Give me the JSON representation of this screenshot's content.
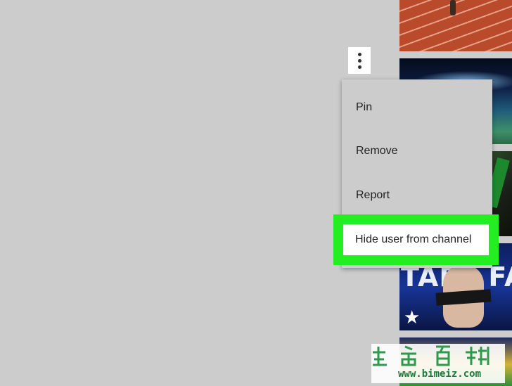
{
  "more_button": {
    "icon": "more-vertical-icon"
  },
  "context_menu": {
    "items": [
      {
        "label": "Pin"
      },
      {
        "label": "Remove"
      },
      {
        "label": "Report"
      },
      {
        "label": "Hide user from channel",
        "highlighted": true
      }
    ]
  },
  "thumbnails": {
    "talent_overlay_text": "TAPE FA",
    "talent_icon": "star-icon"
  },
  "watermark": {
    "url": "www.bimeiz.com",
    "color": "#1d7a3a"
  },
  "colors": {
    "background": "#cccccc",
    "highlight": "#22ee22"
  }
}
